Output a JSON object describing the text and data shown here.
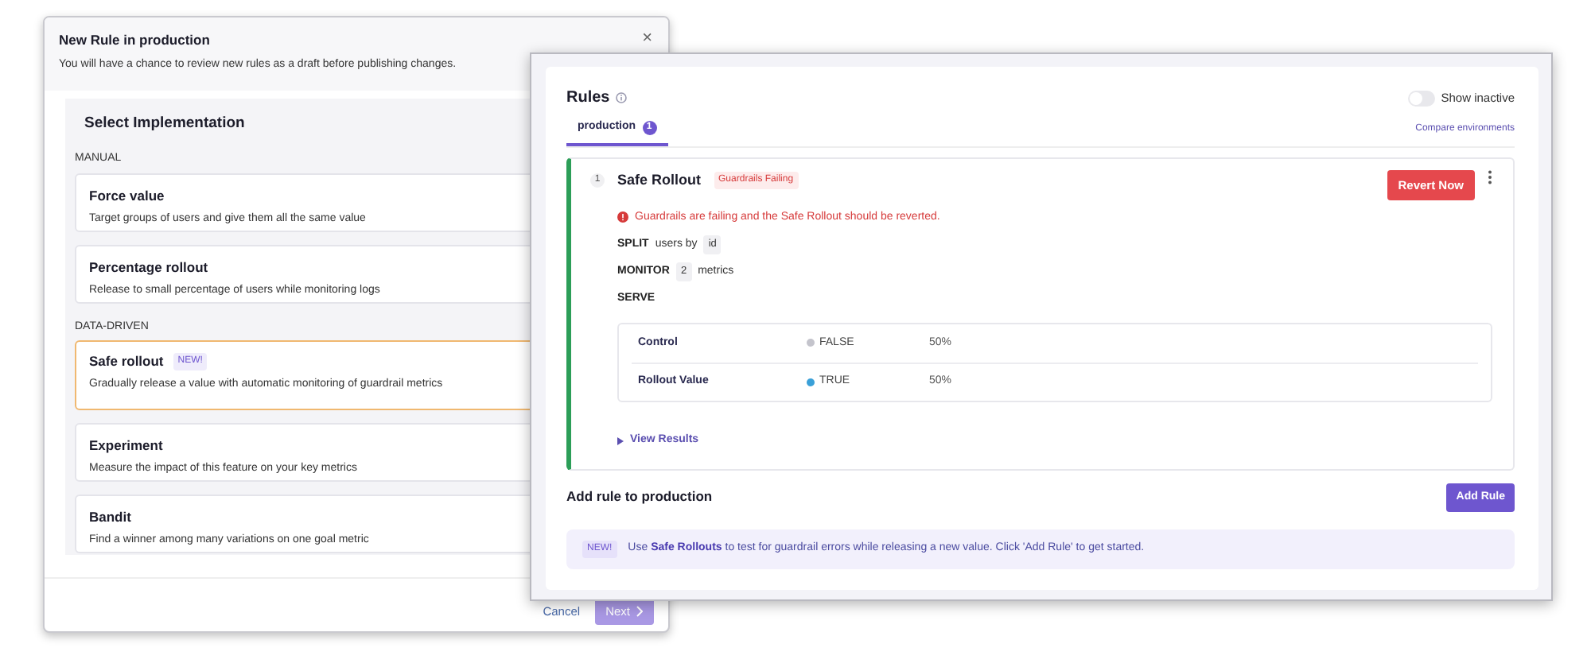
{
  "dialog": {
    "title": "New Rule in production",
    "subtitle": "You will have a chance to review new rules as a draft before publishing changes.",
    "close": "×",
    "section_title": "Select Implementation",
    "groups": [
      {
        "label": "MANUAL",
        "options": [
          {
            "title": "Force value",
            "description": "Target groups of users and give them all the same value",
            "selected": false
          },
          {
            "title": "Percentage rollout",
            "description": "Release to small percentage of users while monitoring logs",
            "selected": false
          }
        ]
      },
      {
        "label": "DATA-DRIVEN",
        "options": [
          {
            "title": "Safe rollout",
            "badge": "NEW!",
            "description": "Gradually release a value with automatic monitoring of guardrail metrics",
            "selected": true
          },
          {
            "title": "Experiment",
            "description": "Measure the impact of this feature on your key metrics",
            "selected": false
          },
          {
            "title": "Bandit",
            "description": "Find a winner among many variations on one goal metric",
            "selected": false
          }
        ]
      }
    ],
    "footer": {
      "cancel": "Cancel",
      "next": "Next",
      "next_disabled": true
    }
  },
  "rules_panel": {
    "title": "Rules",
    "show_inactive": {
      "label": "Show inactive",
      "on": false
    },
    "tabs": [
      {
        "label": "production",
        "count": "1",
        "selected": true
      }
    ],
    "compare_link": "Compare environments",
    "rules": [
      {
        "number": "1",
        "title": "Safe Rollout",
        "status_badge": "Guardrails Failing",
        "error": "Guardrails are failing and the Safe Rollout should be reverted.",
        "action": "Revert Now",
        "split": {
          "label": "SPLIT",
          "text": "users by",
          "value": "id"
        },
        "monitor": {
          "label": "MONITOR",
          "value": "2",
          "text": "metrics"
        },
        "serve_label": "SERVE",
        "serve_rows": [
          {
            "name": "Control",
            "value": "FALSE",
            "color": "#c4c4cc",
            "percent": "50%"
          },
          {
            "name": "Rollout Value",
            "value": "TRUE",
            "color": "#3aa0d8",
            "percent": "50%"
          }
        ],
        "view_results": "View Results"
      }
    ],
    "add_rule": {
      "label": "Add rule to production",
      "button": "Add Rule"
    },
    "notice": {
      "badge": "NEW!",
      "text": "Use **Safe Rollouts** to test for guardrail errors while releasing a new value. Click 'Add Rule' to get started."
    }
  }
}
